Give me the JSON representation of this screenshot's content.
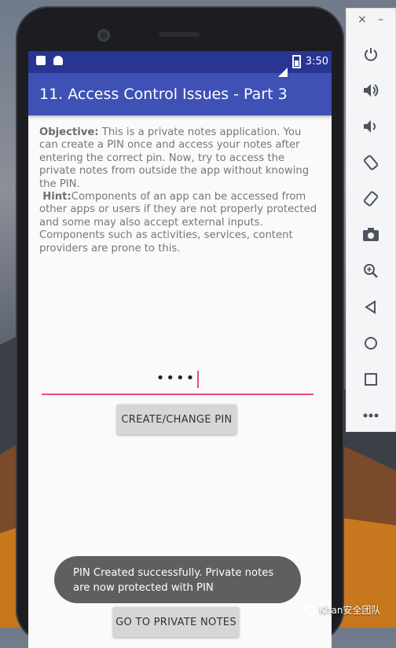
{
  "statusbar": {
    "time": "3:50"
  },
  "app": {
    "title": "11. Access Control Issues - Part 3",
    "objective_label": "Objective:",
    "objective_text": " This is a private notes application. You can create a PIN once and access your notes after entering the correct pin. Now, try to access the private notes from outside the app without knowing the PIN.",
    "hint_label": "Hint:",
    "hint_text": "Components of an app can be accessed from other apps or users if they are not properly protected and some may also accept external inputs. Components such as activities, services, content providers are prone to this.",
    "pin_value": "••••",
    "create_button": "CREATE/CHANGE PIN",
    "private_button": "GO TO PRIVATE NOTES",
    "toast": "PIN Created successfully. Private notes are now protected with PIN"
  },
  "toolbar": {
    "close": "×",
    "minimize": "–",
    "icons": [
      "power-icon",
      "volume-up-icon",
      "volume-down-icon",
      "rotate-left-icon",
      "rotate-right-icon",
      "camera-icon",
      "zoom-icon",
      "back-icon",
      "home-icon",
      "overview-icon",
      "more-icon"
    ]
  },
  "watermark": {
    "text": "Khan安全团队"
  },
  "colors": {
    "appbar": "#3f51b5",
    "statusbar": "#283593",
    "accent": "#e84b7d"
  }
}
